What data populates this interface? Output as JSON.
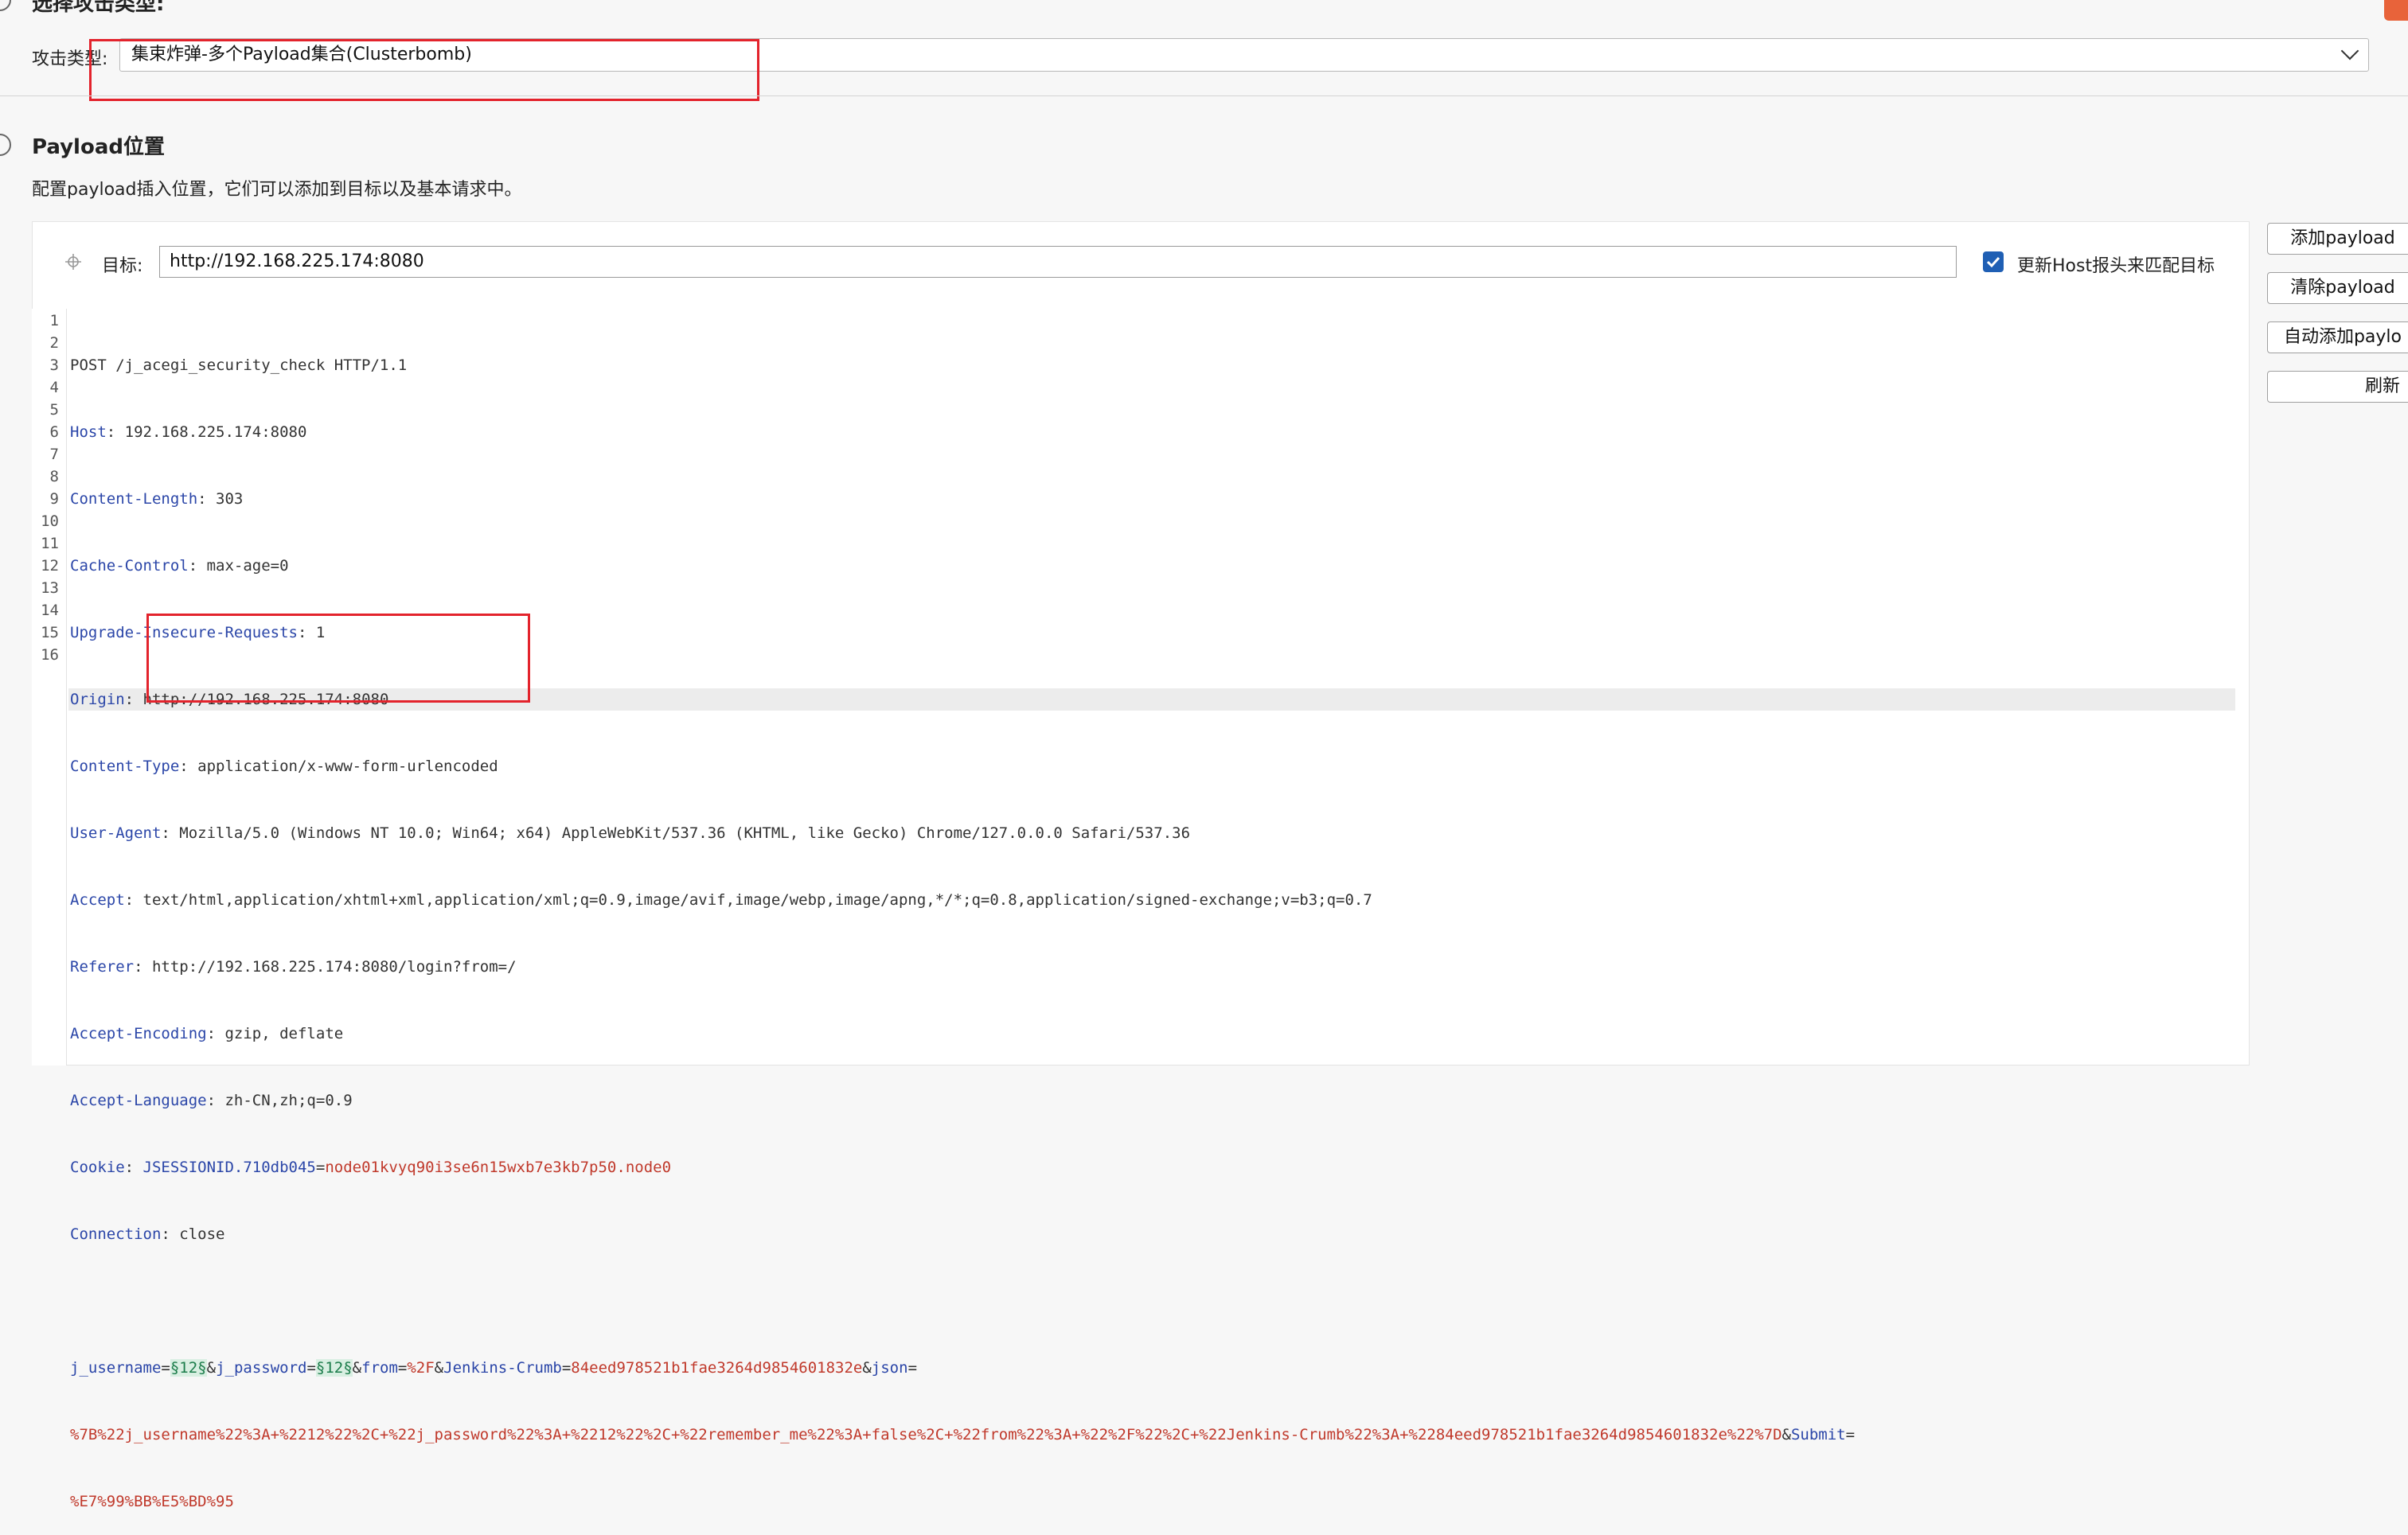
{
  "attack_section": {
    "title": "选择攻击类型:",
    "label": "攻击类型:",
    "selected_type": "集束炸弹-多个Payload集合(Clusterbomb)"
  },
  "positions_section": {
    "title": "Payload位置",
    "description": "配置payload插入位置，它们可以添加到目标以及基本请求中。",
    "target_label": "目标:",
    "target_value": "http://192.168.225.174:8080",
    "update_host_checked": true,
    "update_host_label": "更新Host报头来匹配目标"
  },
  "buttons": {
    "add": "添加payload",
    "clear": "清除payload",
    "auto": "自动添加paylo",
    "refresh": "刷新"
  },
  "request": {
    "line_numbers": [
      "1",
      "2",
      "3",
      "4",
      "5",
      "6",
      "7",
      "8",
      "9",
      "10",
      "11",
      "12",
      "13",
      "14",
      "15",
      "16"
    ],
    "request_line": "POST /j_acegi_security_check HTTP/1.1",
    "headers": [
      {
        "name": "Host",
        "value": "192.168.225.174:8080"
      },
      {
        "name": "Content-Length",
        "value": "303"
      },
      {
        "name": "Cache-Control",
        "value": "max-age=0"
      },
      {
        "name": "Upgrade-Insecure-Requests",
        "value": "1"
      },
      {
        "name": "Origin",
        "value": "http://192.168.225.174:8080"
      },
      {
        "name": "Content-Type",
        "value": "application/x-www-form-urlencoded"
      },
      {
        "name": "User-Agent",
        "value": "Mozilla/5.0 (Windows NT 10.0; Win64; x64) AppleWebKit/537.36 (KHTML, like Gecko) Chrome/127.0.0.0 Safari/537.36"
      },
      {
        "name": "Accept",
        "value": "text/html,application/xhtml+xml,application/xml;q=0.9,image/avif,image/webp,image/apng,*/*;q=0.8,application/signed-exchange;v=b3;q=0.7"
      },
      {
        "name": "Referer",
        "value": "http://192.168.225.174:8080/login?from=/"
      },
      {
        "name": "Accept-Encoding",
        "value": "gzip, deflate"
      },
      {
        "name": "Accept-Language",
        "value": "zh-CN,zh;q=0.9"
      }
    ],
    "cookie_name": "Cookie",
    "cookie_key": "JSESSIONID.710db045",
    "cookie_value": "node01kvyq90i3se6n15wxb7e3kb7p50.node0",
    "connection_name": "Connection",
    "connection_value": "close",
    "body": {
      "p1_name": "j_username",
      "p1_marker": "§12§",
      "p2_name": "j_password",
      "p2_marker": "§12§",
      "p3_name": "from",
      "p3_value": "%2F",
      "p4_name": "Jenkins-Crumb",
      "p4_value": "84eed978521b1fae3264d9854601832e",
      "p5_name": "json",
      "json_value": "%7B%22j_username%22%3A+%2212%22%2C+%22j_password%22%3A+%2212%22%2C+%22remember_me%22%3A+false%2C+%22from%22%3A+%22%2F%22%2C+%22Jenkins-Crumb%22%3A+%2284eed978521b1fae3264d9854601832e%22%7D",
      "p6_name": "Submit",
      "submit_value": "%E7%99%BB%E5%BD%95"
    }
  }
}
